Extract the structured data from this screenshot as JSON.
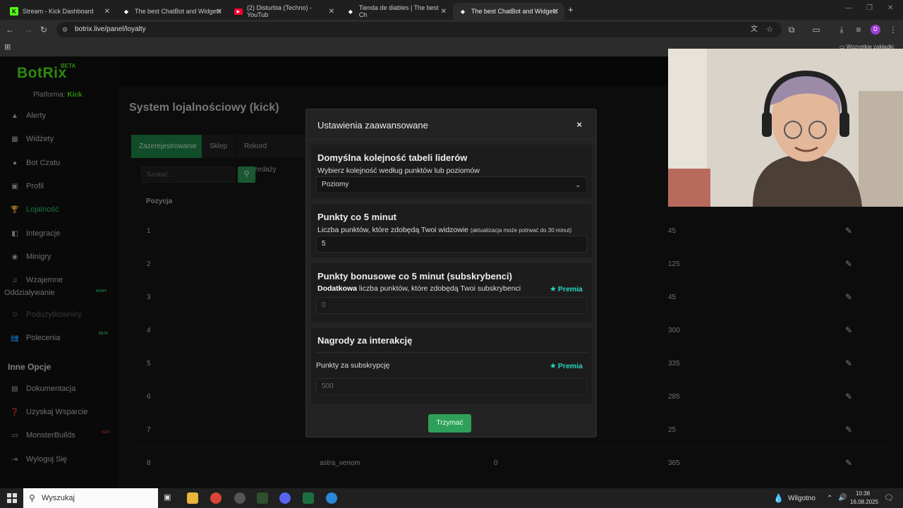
{
  "browser": {
    "tabs": [
      {
        "label": "Stream - Kick Dashboard",
        "icon": "K"
      },
      {
        "label": "The best ChatBot and Widgets",
        "icon": "◆"
      },
      {
        "label": "(2) Disturbia (Techno) - YouTub",
        "icon": "▶"
      },
      {
        "label": "Tienda de diables | The best Ch",
        "icon": "◆"
      },
      {
        "label": "The best ChatBot and Widgets",
        "icon": "◆"
      }
    ],
    "url": "botrix.live/panel/loyalty",
    "bookmarks_label": "Wszystkie zakładki",
    "profile_initial": "D"
  },
  "app": {
    "logo": "BotRix",
    "beta": "BETA",
    "platform_label": "Platforma:",
    "platform_value": "Kick"
  },
  "sidebar": {
    "items": [
      {
        "label": "Alerty",
        "icon": "alert-triangle-icon"
      },
      {
        "label": "Widżety",
        "icon": "widget-icon"
      },
      {
        "label": "Bot Czatu",
        "icon": "bot-icon"
      },
      {
        "label": "Profil",
        "icon": "profile-icon"
      },
      {
        "label": "Lojalność",
        "icon": "trophy-icon"
      },
      {
        "label": "Integracje",
        "icon": "integration-icon"
      },
      {
        "label": "Minigry",
        "icon": "gamepad-icon"
      },
      {
        "label": "Wzajemne",
        "label2": "Oddziaływanie",
        "icon": "music-icon",
        "tag": "NOWY"
      },
      {
        "label": "Podużytkownicy",
        "icon": "subuser-icon"
      },
      {
        "label": "Polecenia",
        "icon": "users-icon",
        "tag": "BETA"
      }
    ],
    "section_label": "Inne Opcje",
    "other_items": [
      {
        "label": "Dokumentacja",
        "icon": "docs-icon"
      },
      {
        "label": "Uzyskaj Wsparcie",
        "icon": "help-icon"
      },
      {
        "label": "MonsterBuilds",
        "icon": "monitor-icon",
        "tag": "NEW"
      },
      {
        "label": "Wyloguj Się",
        "icon": "logout-icon"
      }
    ]
  },
  "content": {
    "title": "System lojalnościowy (kick)",
    "tabs": [
      "Zazerejestrowanie",
      "Sklep",
      "Rekord sprzedaży"
    ],
    "search_placeholder": "Szukać...",
    "col_position": "Pozycja",
    "rows": [
      {
        "pos": "1",
        "name": "",
        "level": "",
        "points": "45"
      },
      {
        "pos": "2",
        "name": "",
        "level": "",
        "points": "125"
      },
      {
        "pos": "3",
        "name": "",
        "level": "",
        "points": "45"
      },
      {
        "pos": "4",
        "name": "",
        "level": "",
        "points": "300"
      },
      {
        "pos": "5",
        "name": "",
        "level": "",
        "points": "335"
      },
      {
        "pos": "6",
        "name": "",
        "level": "",
        "points": "285"
      },
      {
        "pos": "7",
        "name": "",
        "level": "",
        "points": "25"
      },
      {
        "pos": "8",
        "name": "astra_venom",
        "level": "0",
        "points": "365"
      }
    ]
  },
  "modal": {
    "title": "Ustawienia zaawansowane",
    "close": "×",
    "section1": {
      "title": "Domyślna kolejność tabeli liderów",
      "desc": "Wybierz kolejność według punktów lub poziomów",
      "value": "Poziomy"
    },
    "section2": {
      "title": "Punkty co 5 minut",
      "desc": "Liczba punktów, które zdobędą Twoi widzowie",
      "note": "(aktualizacja może potrwać do 30 minut)",
      "value": "5"
    },
    "section3": {
      "title": "Punkty bonusowe co 5 minut (subskrybenci)",
      "desc_bold": "Dodatkowa",
      "desc": " liczba punktów, które zdobędą Twoi subskrybenci",
      "premia": "Premia",
      "value": "0"
    },
    "section4": {
      "title": "Nagrody za interakcję",
      "label": "Punkty za subskrypcję",
      "premia": "Premia",
      "value": "500"
    },
    "save": "Trzymać"
  },
  "taskbar": {
    "search": "Wyszukaj",
    "weather": "Wilgotno",
    "time": "10:38",
    "date": "16.08.2025"
  }
}
